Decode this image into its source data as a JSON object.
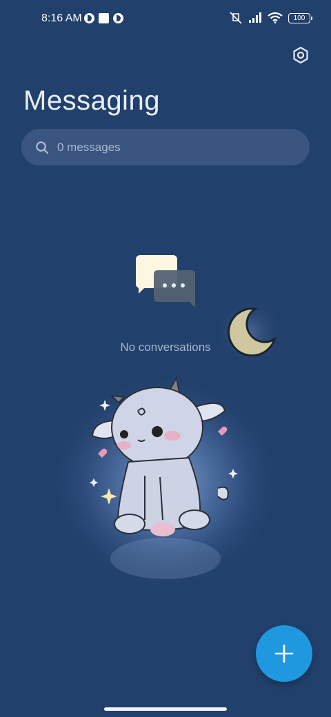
{
  "status_bar": {
    "time": "8:16 AM",
    "battery": "100"
  },
  "header": {
    "title": "Messaging"
  },
  "search": {
    "placeholder": "0 messages"
  },
  "empty_state": {
    "text": "No conversations"
  },
  "fab": {
    "label": "+"
  },
  "colors": {
    "background": "#22406c",
    "search_bg": "#3a5580",
    "fab": "#1f98e0"
  },
  "icons": {
    "settings": "gear-icon",
    "search": "search-icon",
    "compose": "plus-icon"
  }
}
